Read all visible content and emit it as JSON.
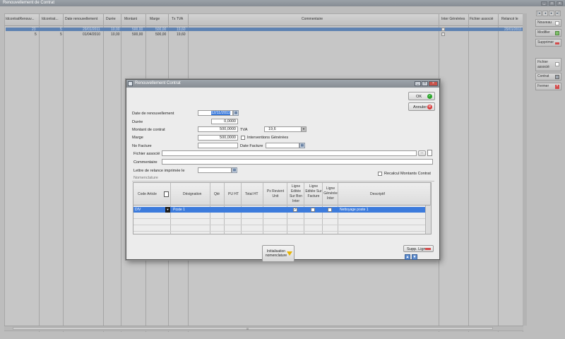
{
  "background": {
    "title": "Renouvellement de Contrat",
    "columns": [
      "IdcontratRenouv...",
      "Idcontrat...",
      "Date renouvellement",
      "Durée",
      "Montant",
      "Marge",
      "Tx TVA",
      "Commentaire",
      "Inter Générées",
      "Fichier associé",
      "Relancé le"
    ],
    "rows": [
      {
        "id": "23",
        "contrat": "5",
        "date": "29/01/2011",
        "duree": "10,00",
        "montant": "500,00",
        "marge": "500,00",
        "tva": "19,60",
        "relance": "29/01/2011"
      },
      {
        "id": "5",
        "contrat": "5",
        "date": "01/04/2010",
        "duree": "10,00",
        "montant": "500,00",
        "marge": "500,00",
        "tva": "19,60",
        "relance": ""
      }
    ],
    "side_buttons": [
      "Nouveau",
      "Modifier",
      "Supprimer",
      "Fichier associé",
      "Contrat",
      "Fermer"
    ],
    "scroll_marker": "III"
  },
  "dialog": {
    "title": "Renouvellement Contrat",
    "ok_label": "OK",
    "cancel_label": "Annuler",
    "fields": {
      "date_label": "Date de renouvellement",
      "date_value": "12/11/2011",
      "duree_label": "Durée",
      "duree_value": "0,0000",
      "montant_label": "Montant de contrat",
      "montant_value": "500,0000",
      "tva_label": "TVA",
      "tva_value": "19,6",
      "marge_label": "Marge",
      "marge_value": "500,0000",
      "interventions_label": "Interventions Générées",
      "nofacture_label": "No Facture",
      "nofacture_value": "",
      "datefacture_label": "Date Facture",
      "datefacture_value": "",
      "fichier_label": "Fichier associé",
      "fichier_value": "",
      "fichier_browse": "...",
      "commentaire_label": "Commentaire",
      "commentaire_value": "",
      "lettre_label": "Lettre de relance imprimée le",
      "lettre_value": "",
      "recalcul_label": "Recalcul Montants Contrat"
    },
    "nomenclature_label": "Nomenclature",
    "grid": {
      "headers": [
        "Code Article",
        "Désignation",
        "Qté",
        "PU HT",
        "Total HT",
        "Px Revient Unit",
        "Ligne Editée Sur Bon Inter",
        "Ligne Editée Sur Facture",
        "Ligne Générée Inter",
        "Descriptif"
      ],
      "row": {
        "code": "DIV",
        "designation": "Poste 1",
        "descriptif": "Nettoyage poste 1"
      }
    },
    "init_label": "Initialisation nomenclature",
    "supp_label": "Supp. Ligne"
  },
  "colors": {
    "selection": "#3c7bdc",
    "title_bar": "#8f959c",
    "ok_icon": "#2aa52a",
    "cancel_icon": "#d93a3a"
  }
}
